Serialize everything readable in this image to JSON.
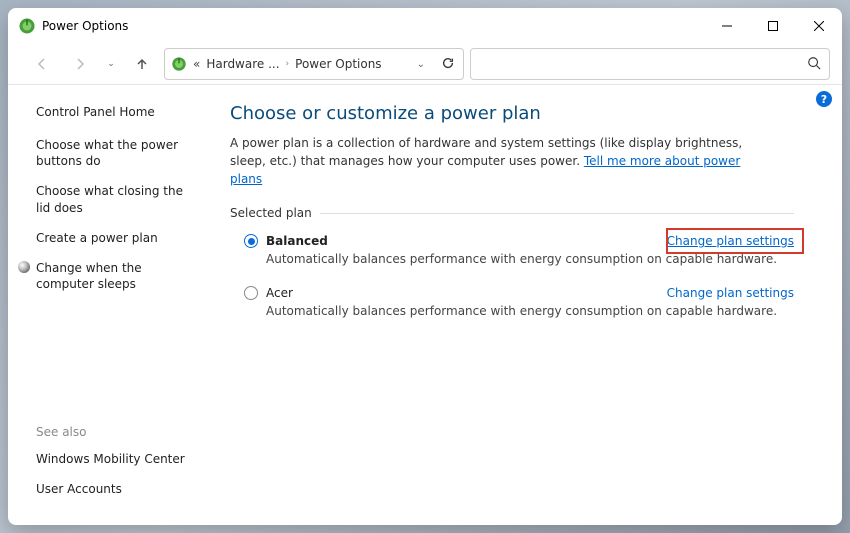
{
  "titlebar": {
    "title": "Power Options"
  },
  "nav": {
    "breadcrumb_ellipsis": "«",
    "breadcrumb1": "Hardware ...",
    "breadcrumb2": "Power Options"
  },
  "sidebar": {
    "home": "Control Panel Home",
    "links": [
      "Choose what the power buttons do",
      "Choose what closing the lid does",
      "Create a power plan",
      "Change when the computer sleeps"
    ],
    "see_also_label": "See also",
    "see_also": [
      "Windows Mobility Center",
      "User Accounts"
    ]
  },
  "main": {
    "title": "Choose or customize a power plan",
    "description_1": "A power plan is a collection of hardware and system settings (like display brightness, sleep, etc.) that manages how your computer uses power. ",
    "learn_more": "Tell me more about power plans",
    "section_label": "Selected plan",
    "plans": [
      {
        "name": "Balanced",
        "selected": true,
        "change": "Change plan settings",
        "desc": "Automatically balances performance with energy consumption on capable hardware."
      },
      {
        "name": "Acer",
        "selected": false,
        "change": "Change plan settings",
        "desc": "Automatically balances performance with energy consumption on capable hardware."
      }
    ]
  },
  "help": "?"
}
